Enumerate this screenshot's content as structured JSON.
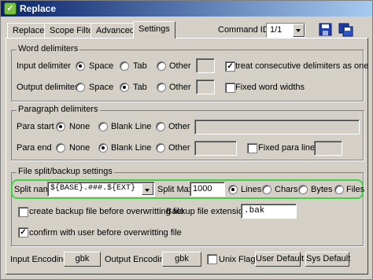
{
  "window": {
    "title": "Replace",
    "app_icon": "notepad-icon"
  },
  "tabs": [
    {
      "label": "Replace",
      "active": false
    },
    {
      "label": "Scope Filter",
      "active": false
    },
    {
      "label": "Advanced",
      "active": false
    },
    {
      "label": "Settings",
      "active": true
    }
  ],
  "command": {
    "label": "Command ID =>",
    "value": "1/1",
    "save_icon": "save-disk-icon",
    "save_all_icon": "save-all-icon"
  },
  "word_delimiters": {
    "title": "Word delimiters",
    "input": {
      "label": "Input   delimiter",
      "space": "Space",
      "tab": "Tab",
      "other": "Other",
      "selected": "space",
      "other_value": "",
      "consecutive_label": "treat consecutive delimiters as one",
      "consecutive_checked": true
    },
    "output": {
      "label": "Output delimiter",
      "space": "Space",
      "tab": "Tab",
      "other": "Other",
      "selected": "tab",
      "other_value": "",
      "fixed_label": "Fixed word widths",
      "fixed_checked": false
    }
  },
  "paragraph_delimiters": {
    "title": "Paragraph delimiters",
    "start": {
      "label": "Para start",
      "none": "None",
      "blank": "Blank Line",
      "other": "Other",
      "selected": "none",
      "other_value": ""
    },
    "end": {
      "label": "Para end",
      "none": "None",
      "blank": "Blank Line",
      "other": "Other",
      "selected": "blank",
      "other_value": "",
      "fixed_label": "Fixed para lines",
      "fixed_checked": false
    }
  },
  "split": {
    "title": "File split/backup settings",
    "name_label": "Split name:",
    "name_value": "${BASE}.###.${EXT}",
    "max_label": "Split Max:",
    "max_value": "1000",
    "lines": "Lines",
    "chars": "Chars",
    "bytes": "Bytes",
    "files": "Files",
    "selected": "lines",
    "backup_label": "create backup file before overwritting file",
    "backup_checked": false,
    "ext_label": "Backup file extension:",
    "ext_value": ".bak",
    "confirm_label": "confirm with user before overwritting file",
    "confirm_checked": true
  },
  "bottom": {
    "input_label": "Input  Encoding:",
    "input_value": "gbk",
    "output_label": "Output Encoding:",
    "output_value": "gbk",
    "unix_label": "Unix Flag",
    "unix_checked": false,
    "user_default": "User Default",
    "sys_default": "Sys Default"
  }
}
